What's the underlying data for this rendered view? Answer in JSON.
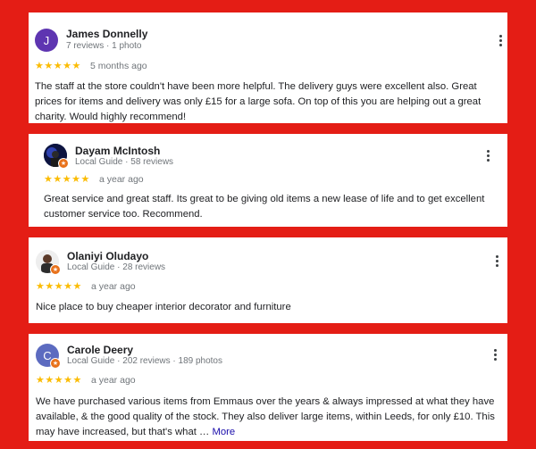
{
  "colors": {
    "background": "#e41d15",
    "star": "#fbbc04",
    "link": "#1a0dab"
  },
  "reviews": [
    {
      "avatar_letter": "J",
      "avatar_color": "#5e35b1",
      "name": "James Donnelly",
      "meta": "7 reviews · 1 photo",
      "stars": "★★★★★",
      "rating": 5,
      "time": "5 months ago",
      "text": "The staff at the store couldn't have been more helpful. The delivery guys were excellent also. Great prices for items and delivery was only £15 for a large sofa. On top of this you are helping out a great charity. Would highly recommend!"
    },
    {
      "avatar_icon": "profile-photo-icon",
      "name": "Dayam McIntosh",
      "meta": "Local Guide · 58 reviews",
      "stars": "★★★★★",
      "rating": 5,
      "time": "a year ago",
      "text": "Great service and great staff. Its great to be giving old items a new lease of life and to get excellent customer service too. Recommend."
    },
    {
      "avatar_icon": "profile-photo-icon",
      "name": "Olaniyi Oludayo",
      "meta": "Local Guide · 28 reviews",
      "stars": "★★★★★",
      "rating": 5,
      "time": "a year ago",
      "text": "Nice place to buy cheaper interior decorator and furniture"
    },
    {
      "avatar_letter": "C",
      "avatar_color": "#5c6bc0",
      "name": "Carole Deery",
      "meta": "Local Guide · 202 reviews · 189 photos",
      "stars": "★★★★★",
      "rating": 5,
      "time": "a year ago",
      "text": "We have purchased various items from Emmaus over the years & always impressed at what they have available, & the good quality of the stock. They also deliver large items, within Leeds, for only £10. This may have increased, but that's what …",
      "more_label": "More"
    }
  ]
}
